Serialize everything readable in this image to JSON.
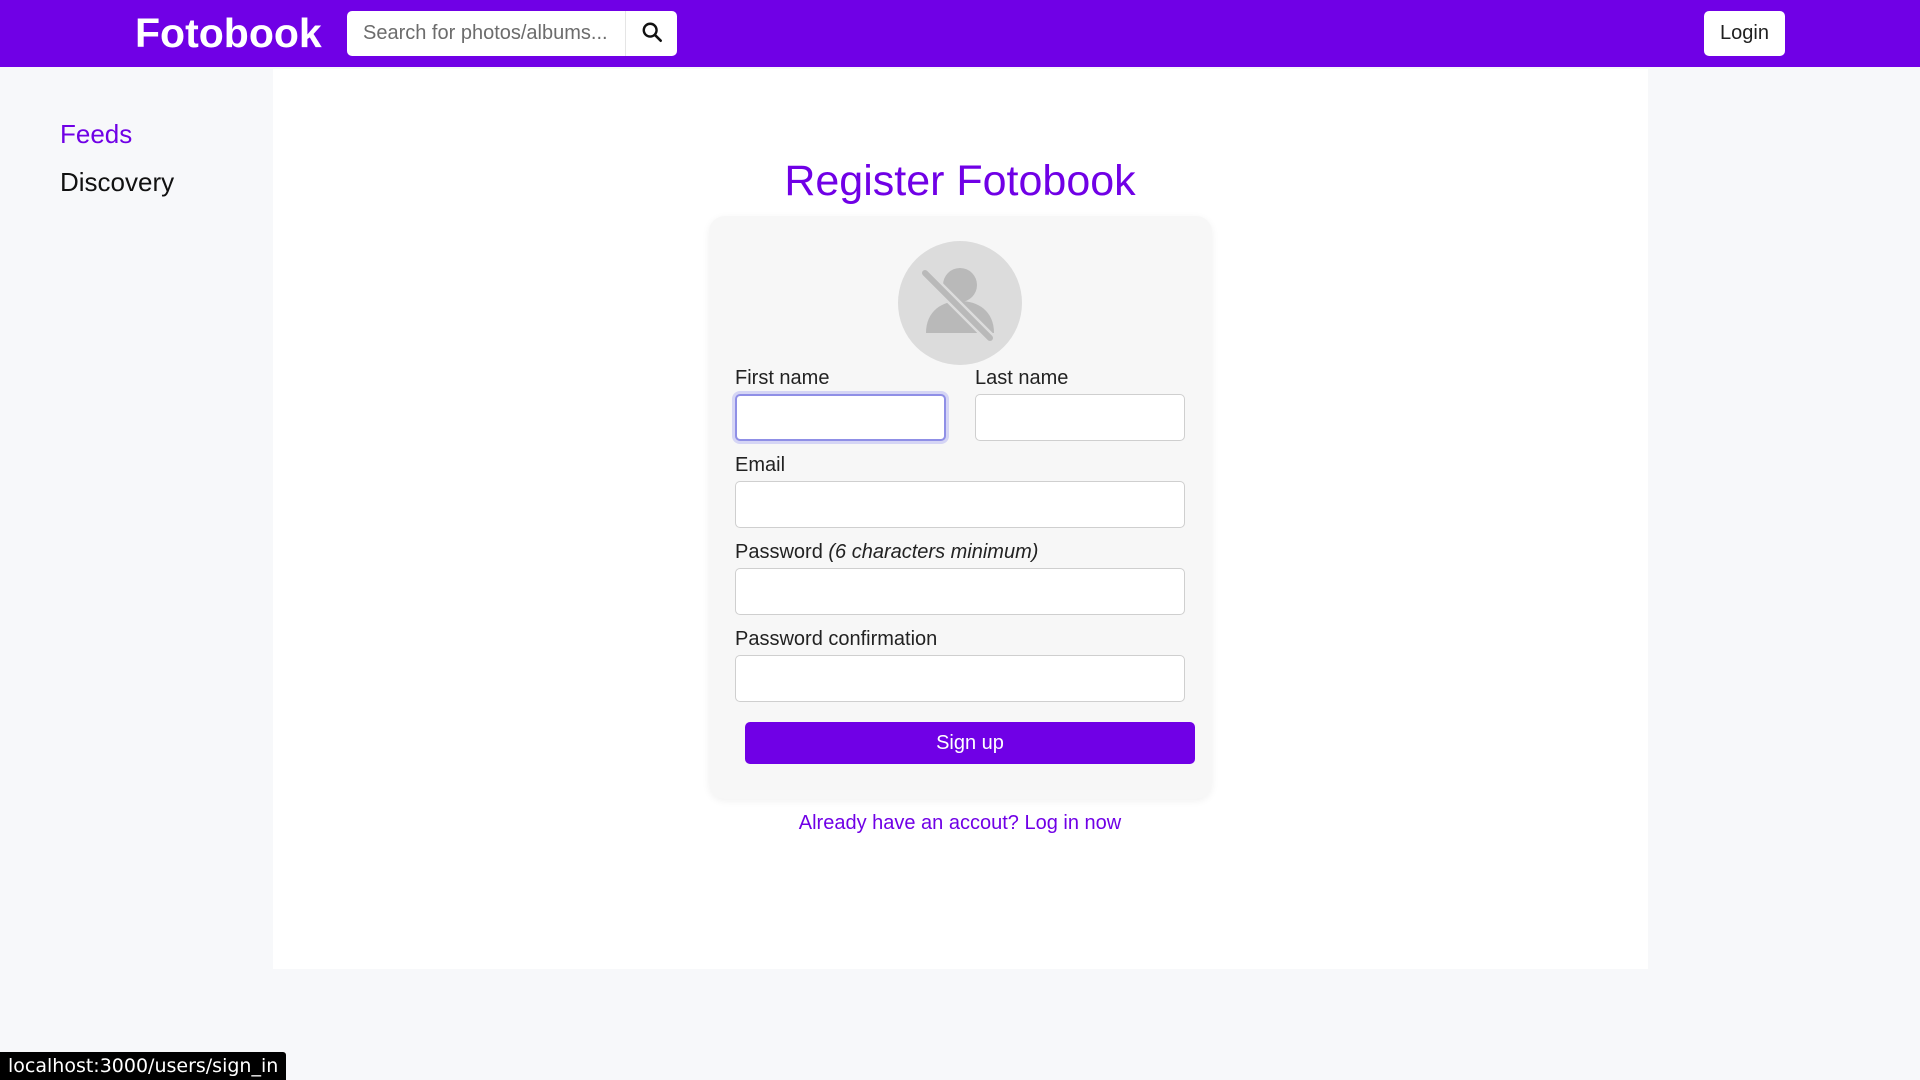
{
  "header": {
    "brand": "Fotobook",
    "search_placeholder": "Search for photos/albums...",
    "search_icon": "search-icon",
    "login_label": "Login"
  },
  "sidebar": {
    "items": [
      {
        "label": "Feeds",
        "active": true
      },
      {
        "label": "Discovery",
        "active": false
      }
    ]
  },
  "form": {
    "title": "Register Fotobook",
    "avatar_icon": "user-slash-icon",
    "first_name_label": "First name",
    "first_name_value": "",
    "last_name_label": "Last name",
    "last_name_value": "",
    "email_label": "Email",
    "email_value": "",
    "password_label": "Password",
    "password_hint": "(6 characters minimum)",
    "password_value": "",
    "password_confirmation_label": "Password confirmation",
    "password_confirmation_value": "",
    "signup_label": "Sign up",
    "login_prompt": "Already have an accout? Log in now"
  },
  "status_bar": {
    "url": "localhost:3000/users/sign_in"
  },
  "colors": {
    "brand": "#7000e6",
    "page_background": "#f7f8fa",
    "card_background": "#f7f7f7"
  }
}
